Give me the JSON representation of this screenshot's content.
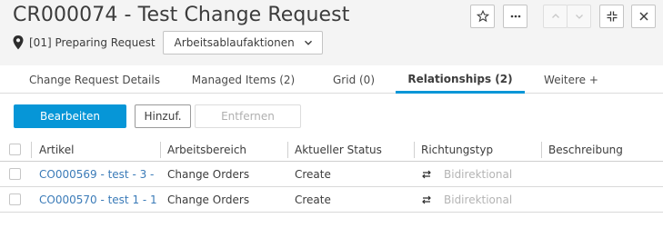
{
  "header": {
    "title": "CR000074 - Test Change Request",
    "state": "[01] Preparing Request",
    "actions_label": "Arbeitsablaufaktionen",
    "buttons": [
      {
        "name": "favorite-star-icon"
      },
      {
        "name": "more-options-icon"
      },
      {
        "name": "previous-item-icon"
      },
      {
        "name": "next-item-icon"
      },
      {
        "name": "collapse-icon"
      },
      {
        "name": "close-icon"
      }
    ]
  },
  "tabs": [
    {
      "label": "Change Request Details",
      "active": false
    },
    {
      "label": "Managed Items (2)",
      "active": false
    },
    {
      "label": "Grid (0)",
      "active": false
    },
    {
      "label": "Relationships (2)",
      "active": true
    },
    {
      "label": "Weitere +",
      "active": false
    }
  ],
  "toolbar": {
    "edit_label": "Bearbeiten",
    "add_label": "Hinzuf.",
    "remove_label": "Entfernen"
  },
  "table": {
    "columns": [
      "Artikel",
      "Arbeitsbereich",
      "Aktueller Status",
      "Richtungstyp",
      "Beschreibung"
    ],
    "rows": [
      {
        "artikel": "CO000569 - test - 3 - ...",
        "arbeitsbereich": "Change Orders",
        "status": "Create",
        "richtungstyp": "Bidirektional",
        "beschreibung": ""
      },
      {
        "artikel": "CO000570 - test 1 - 1 -...",
        "arbeitsbereich": "Change Orders",
        "status": "Create",
        "richtungstyp": "Bidirektional",
        "beschreibung": ""
      }
    ]
  },
  "colors": {
    "accent": "#0696d7",
    "link": "#3b7bb8",
    "header_bg": "#f4f4f4"
  }
}
